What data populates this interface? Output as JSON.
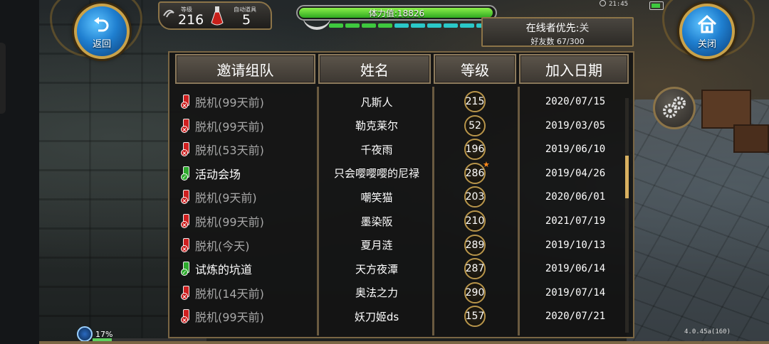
{
  "top": {
    "back_label": "返回",
    "close_label": "关闭",
    "level_caption": "等级",
    "level_value": "216",
    "auto_item_caption": "自动道具",
    "auto_item_value": "5",
    "stamina_text": "体力值:18826",
    "stamina_fraction": 0.98,
    "clock": "21:45",
    "online_priority_label": "在线者优先:",
    "online_priority_value": "关",
    "friends_count": "好友数 67/300"
  },
  "table": {
    "headers": [
      "邀请组队",
      "姓名",
      "等级",
      "加入日期"
    ],
    "rows": [
      {
        "status": "脱机(99天前)",
        "online": false,
        "name": "凡斯人",
        "level": "215",
        "date": "2020/07/15",
        "star": false
      },
      {
        "status": "脱机(99天前)",
        "online": false,
        "name": "勒克莱尔",
        "level": "52",
        "date": "2019/03/05",
        "star": false
      },
      {
        "status": "脱机(53天前)",
        "online": false,
        "name": "千夜雨",
        "level": "196",
        "date": "2019/06/10",
        "star": false
      },
      {
        "status": "活动会场",
        "online": true,
        "name": "只会嘤嘤嘤的尼禄",
        "level": "286",
        "date": "2019/04/26",
        "star": true
      },
      {
        "status": "脱机(9天前)",
        "online": false,
        "name": "嘲笑猫",
        "level": "203",
        "date": "2020/06/01",
        "star": false
      },
      {
        "status": "脱机(99天前)",
        "online": false,
        "name": "墨染阪",
        "level": "210",
        "date": "2021/07/19",
        "star": false
      },
      {
        "status": "脱机(今天)",
        "online": false,
        "name": "夏月涟",
        "level": "289",
        "date": "2019/10/13",
        "star": false
      },
      {
        "status": "试炼的坑道",
        "online": true,
        "name": "天方夜潭",
        "level": "287",
        "date": "2019/06/14",
        "star": false
      },
      {
        "status": "脱机(14天前)",
        "online": false,
        "name": "奥法之力",
        "level": "290",
        "date": "2019/07/14",
        "star": false
      },
      {
        "status": "脱机(99天前)",
        "online": false,
        "name": "妖刀姬ds",
        "level": "157",
        "date": "2020/07/21",
        "star": false
      }
    ],
    "scroll_fraction": 0.3
  },
  "bottom": {
    "progress_text": "17%",
    "progress_fraction": 0.17,
    "version": "4.0.45a(160)"
  },
  "colors": {
    "offline_text": "#a8a8a8",
    "online_text": "#ffffff",
    "offline_phone": "#d02020",
    "online_phone": "#2eaa2e",
    "stamina_segments": [
      "#3ec83e",
      "#3ec83e",
      "#3ec83e",
      "#3ec83e",
      "#2ac8c8",
      "#2ac8c8",
      "#2ac8c8",
      "#2ac8c8",
      "#2ac8c8",
      "#2ac8c8"
    ]
  }
}
